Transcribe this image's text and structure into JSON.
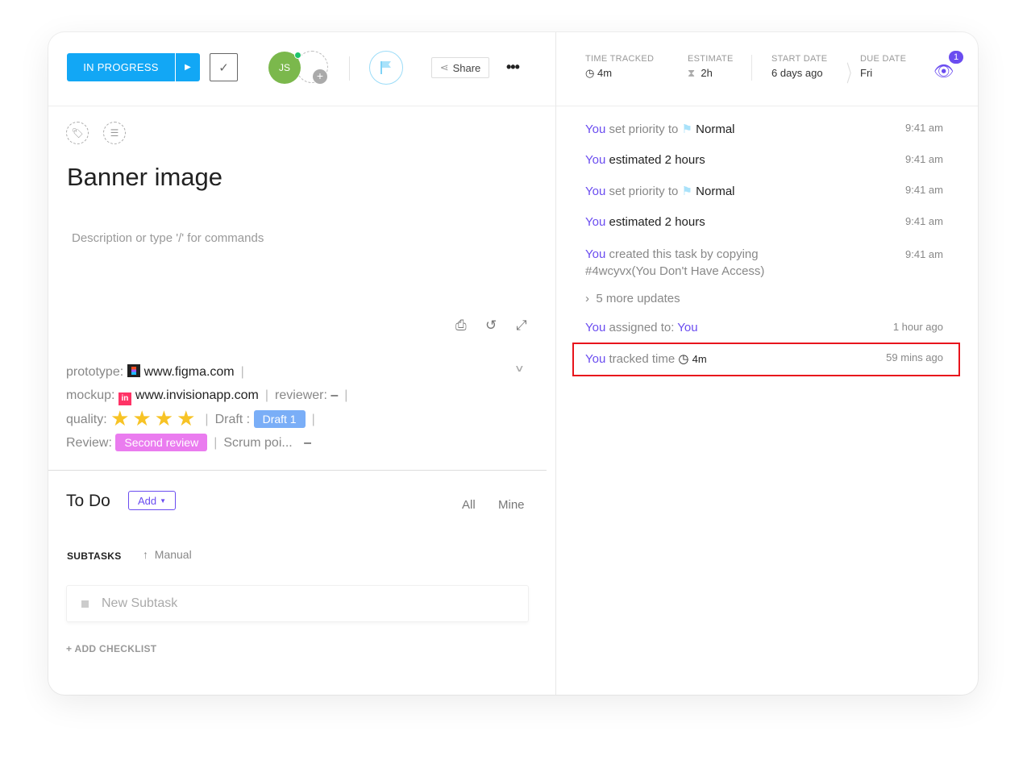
{
  "header": {
    "status": "IN PROGRESS",
    "avatar_initials": "JS",
    "share": "Share",
    "more": "•••"
  },
  "task": {
    "title": "Banner image",
    "description_placeholder": "Description or type '/' for commands"
  },
  "fields": {
    "prototype_label": "prototype:",
    "prototype_value": "www.figma.com",
    "mockup_label": "mockup:",
    "mockup_value": "www.invisionapp.com",
    "reviewer_label": "reviewer:",
    "reviewer_value": "–",
    "quality_label": "quality:",
    "quality_rating": 4,
    "draft_label": "Draft :",
    "draft_value": "Draft 1",
    "review_label": "Review:",
    "review_value": "Second review",
    "scrum_label": "Scrum poi...",
    "scrum_value": "–",
    "colors": {
      "draft": "#7aaef7",
      "review": "#ea7cef"
    }
  },
  "todo": {
    "title": "To Do",
    "add": "Add",
    "all": "All",
    "mine": "Mine",
    "subtasks": "SUBTASKS",
    "manual": "Manual",
    "new_subtask": "New Subtask",
    "add_checklist": "+ ADD CHECKLIST"
  },
  "meta": {
    "time_tracked_label": "TIME TRACKED",
    "time_tracked": "4m",
    "estimate_label": "ESTIMATE",
    "estimate": "2h",
    "start_label": "START DATE",
    "start": "6 days ago",
    "due_label": "DUE DATE",
    "due": "Fri",
    "watchers": "1"
  },
  "activity": [
    {
      "who": "You",
      "text": "set priority to",
      "value": "Normal",
      "time": "9:41 am"
    },
    {
      "who": "You",
      "text": "estimated 2 hours",
      "time": "9:41 am"
    },
    {
      "who": "You",
      "text": "set priority to",
      "value": "Normal",
      "time": "9:41 am"
    },
    {
      "who": "You",
      "text": "estimated 2 hours",
      "time": "9:41 am"
    },
    {
      "who": "You",
      "text": "created this task by copying #4wcyvx(You Don't Have Access)",
      "time": "9:41 am"
    },
    {
      "text": "5 more updates"
    },
    {
      "who": "You",
      "text": "assigned to:",
      "value": "You",
      "time": "1 hour ago"
    },
    {
      "who": "You",
      "text": "tracked time",
      "value": "4m",
      "time": "59 mins ago"
    }
  ]
}
